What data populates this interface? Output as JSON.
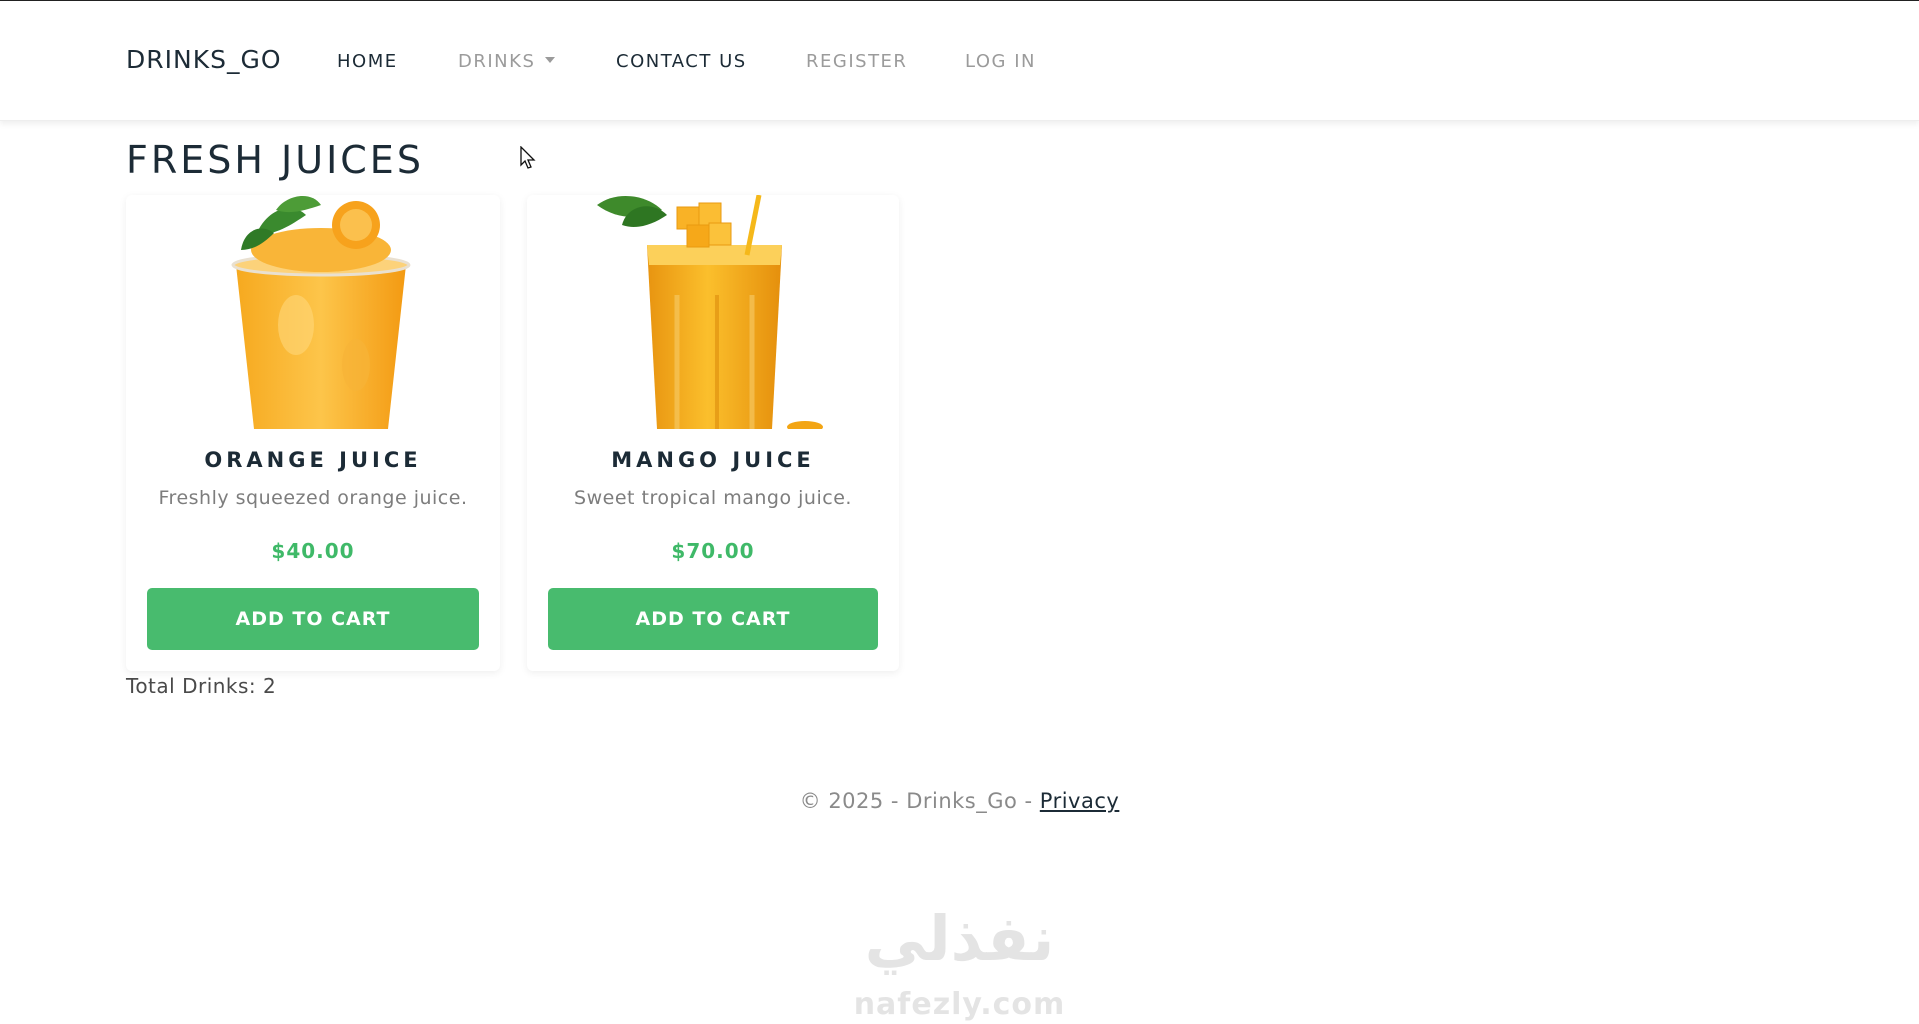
{
  "navbar": {
    "brand": "DRINKS_GO",
    "items": [
      {
        "label": "HOME"
      },
      {
        "label": "DRINKS"
      },
      {
        "label": "CONTACT US"
      },
      {
        "label": "REGISTER"
      },
      {
        "label": "LOG IN"
      }
    ]
  },
  "main": {
    "title": "FRESH JUICES",
    "cards": [
      {
        "name": "ORANGE JUICE",
        "description": "Freshly squeezed orange juice.",
        "price": "$40.00",
        "button": "ADD TO CART",
        "image": "orange-juice-cup"
      },
      {
        "name": "MANGO JUICE",
        "description": "Sweet tropical mango juice.",
        "price": "$70.00",
        "button": "ADD TO CART",
        "image": "mango-juice-glass"
      }
    ],
    "total": "Total Drinks: 2"
  },
  "footer": {
    "text": "© 2025 - Drinks_Go - ",
    "link": "Privacy"
  },
  "watermark": {
    "arabic": "نفذلي",
    "latin": "nafezly.com"
  },
  "colors": {
    "accent_green": "#48bb6e",
    "price_green": "#3fb968",
    "text_dark": "#1c2b36",
    "text_muted": "#9b9b9b"
  }
}
